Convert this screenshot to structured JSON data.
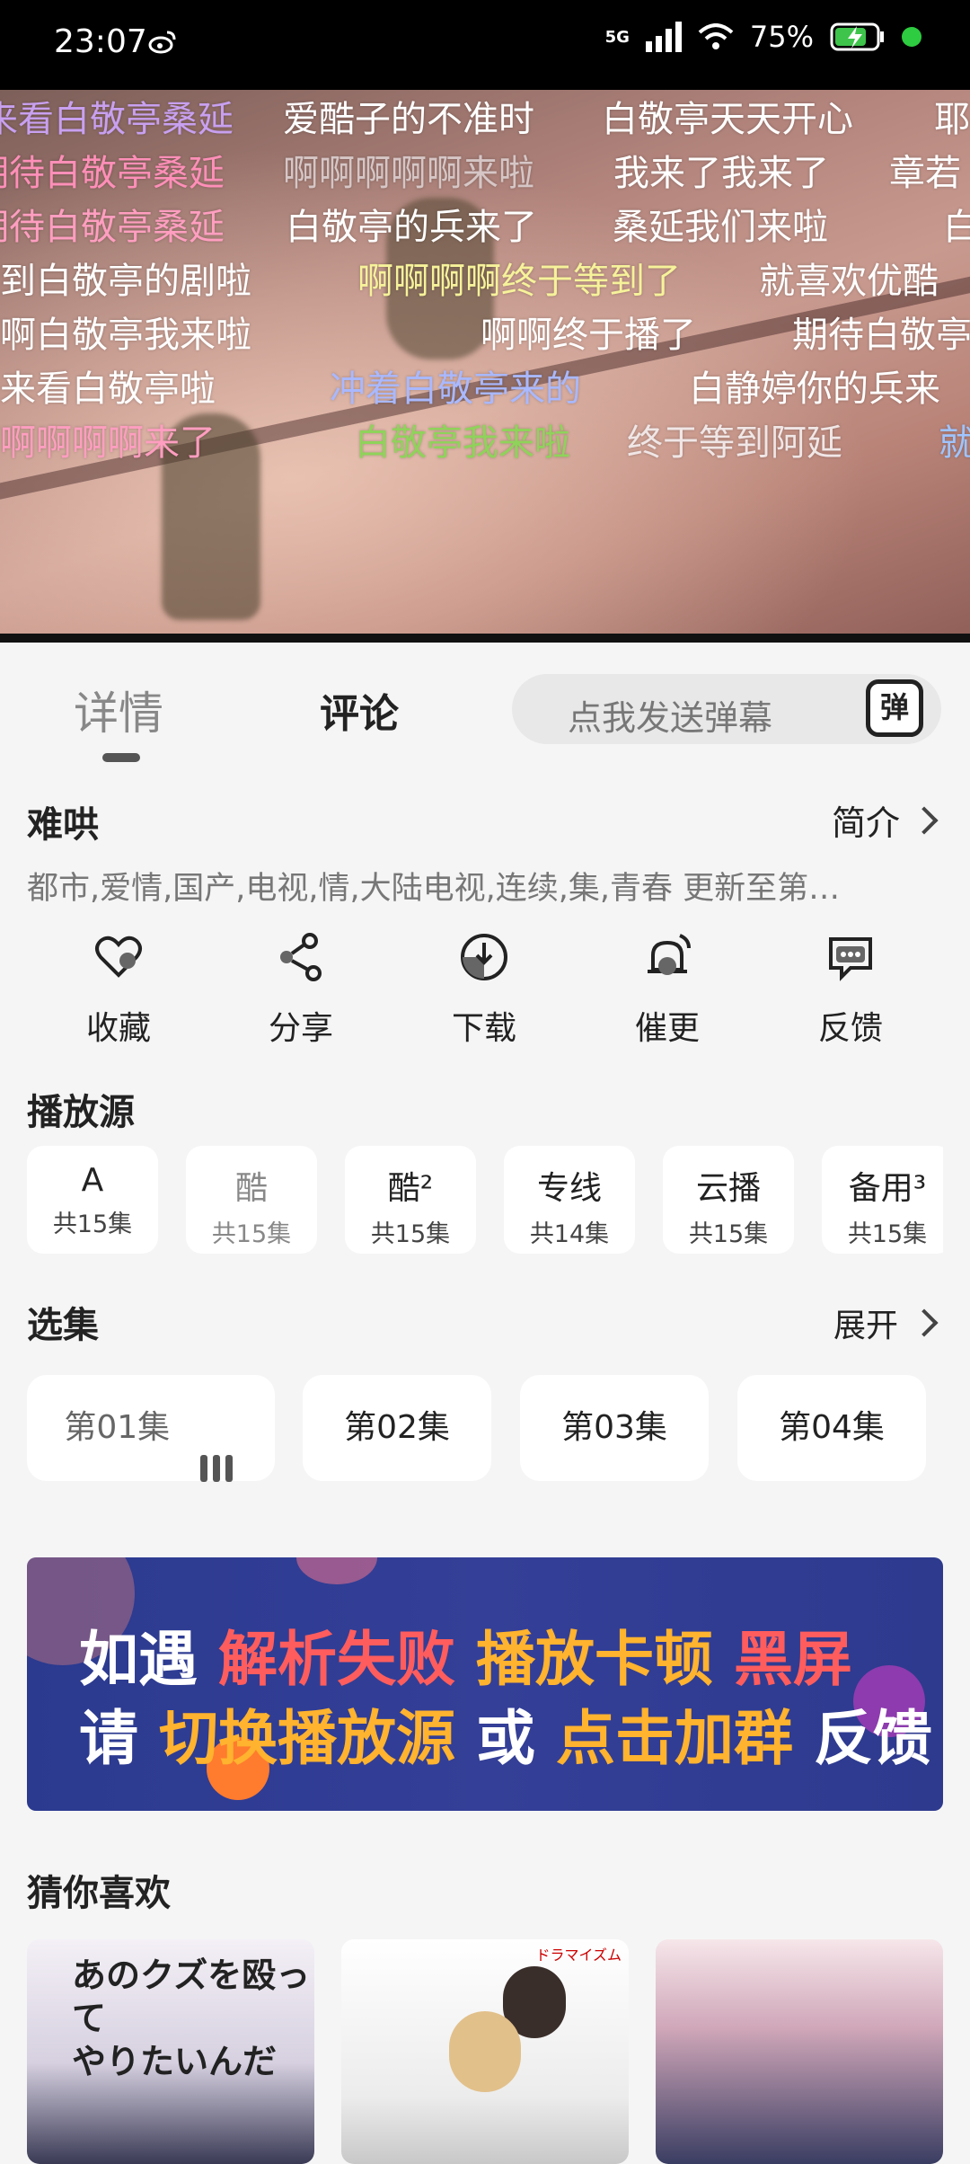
{
  "status_bar": {
    "time": "23:07",
    "network": "5G",
    "battery": "75%"
  },
  "danmaku": [
    {
      "text": "来看白敬亭桑延",
      "color": "#c8a0f0"
    },
    {
      "text": "爱酷子的不准时",
      "color": "#ffffff"
    },
    {
      "text": "白敬亭天天开心",
      "color": "#ffffff"
    },
    {
      "text": "耶",
      "color": "#ffffff"
    },
    {
      "text": "期待白敬亭桑延",
      "color": "#ff8fb8"
    },
    {
      "text": "啊啊啊啊啊来啦",
      "color": "#d6c6c6"
    },
    {
      "text": "我来了我来了",
      "color": "#ffffff"
    },
    {
      "text": "章若",
      "color": "#ffffff"
    },
    {
      "text": "期待白敬亭桑延",
      "color": "#ff9ec0"
    },
    {
      "text": "白敬亭的兵来了",
      "color": "#ffffff"
    },
    {
      "text": "桑延我们来啦",
      "color": "#ffffff"
    },
    {
      "text": "白",
      "color": "#ffffff"
    },
    {
      "text": "看到白敬亭的剧啦",
      "color": "#ffffff"
    },
    {
      "text": "啊啊啊啊终于等到了",
      "color": "#f6f29a"
    },
    {
      "text": "就喜欢优酷",
      "color": "#ffffff"
    },
    {
      "text": "啊啊白敬亭我来啦",
      "color": "#ffffff"
    },
    {
      "text": "啊啊终于播了",
      "color": "#ffffff"
    },
    {
      "text": "期待白敬亭",
      "color": "#ffffff"
    },
    {
      "text": "来看白敬亭啦",
      "color": "#ffffff"
    },
    {
      "text": "冲着白敬亭来的",
      "color": "#a9b8ff"
    },
    {
      "text": "白静婷你的兵来",
      "color": "#ffffff"
    },
    {
      "text": "啊啊啊啊啊来了",
      "color": "#ff9ec0"
    },
    {
      "text": "白敬亭我来啦",
      "color": "#8fd35a"
    },
    {
      "text": "终于等到阿延",
      "color": "#f0e6e6"
    },
    {
      "text": "就",
      "color": "#9fc4ff"
    }
  ],
  "tabs": {
    "detail": "详情",
    "comment": "评论"
  },
  "danmu_input": {
    "placeholder": "点我发送弹幕",
    "button": "弹"
  },
  "show": {
    "title": "难哄",
    "intro_label": "简介",
    "tags": "都市,爱情,国产,电视,情,大陆电视,连续,集,青春 更新至第…"
  },
  "actions": [
    {
      "label": "收藏",
      "icon": "heart-icon"
    },
    {
      "label": "分享",
      "icon": "share-icon"
    },
    {
      "label": "下载",
      "icon": "download-icon"
    },
    {
      "label": "催更",
      "icon": "bell-icon"
    },
    {
      "label": "反馈",
      "icon": "feedback-icon"
    }
  ],
  "sources_title": "播放源",
  "sources": [
    {
      "name": "A",
      "count": "共15集"
    },
    {
      "name": "酷",
      "count": "共15集"
    },
    {
      "name": "酷²",
      "count": "共15集"
    },
    {
      "name": "专线",
      "count": "共14集"
    },
    {
      "name": "云播",
      "count": "共15集"
    },
    {
      "name": "备用³",
      "count": "共15集"
    }
  ],
  "episodes_title": "选集",
  "expand_label": "展开",
  "episodes": [
    "第01集",
    "第02集",
    "第03集",
    "第04集"
  ],
  "banner": {
    "line1": [
      "如遇",
      "解析失败",
      "播放卡顿",
      "黑屏"
    ],
    "line2": [
      "请",
      "切换播放源",
      "或",
      "点击加群",
      "反馈"
    ]
  },
  "recommend_title": "猜你喜欢",
  "posters": [
    {
      "text_line1": "あのクズを殴って",
      "text_line2": "やりたいんだ"
    },
    {
      "tag": "ドラマイズム"
    },
    {}
  ]
}
